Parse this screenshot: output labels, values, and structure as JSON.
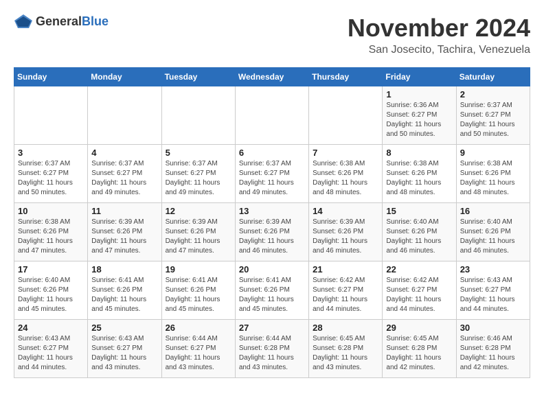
{
  "logo": {
    "general": "General",
    "blue": "Blue"
  },
  "title": "November 2024",
  "subtitle": "San Josecito, Tachira, Venezuela",
  "days_of_week": [
    "Sunday",
    "Monday",
    "Tuesday",
    "Wednesday",
    "Thursday",
    "Friday",
    "Saturday"
  ],
  "weeks": [
    [
      {
        "day": "",
        "info": ""
      },
      {
        "day": "",
        "info": ""
      },
      {
        "day": "",
        "info": ""
      },
      {
        "day": "",
        "info": ""
      },
      {
        "day": "",
        "info": ""
      },
      {
        "day": "1",
        "info": "Sunrise: 6:36 AM\nSunset: 6:27 PM\nDaylight: 11 hours\nand 50 minutes."
      },
      {
        "day": "2",
        "info": "Sunrise: 6:37 AM\nSunset: 6:27 PM\nDaylight: 11 hours\nand 50 minutes."
      }
    ],
    [
      {
        "day": "3",
        "info": "Sunrise: 6:37 AM\nSunset: 6:27 PM\nDaylight: 11 hours\nand 50 minutes."
      },
      {
        "day": "4",
        "info": "Sunrise: 6:37 AM\nSunset: 6:27 PM\nDaylight: 11 hours\nand 49 minutes."
      },
      {
        "day": "5",
        "info": "Sunrise: 6:37 AM\nSunset: 6:27 PM\nDaylight: 11 hours\nand 49 minutes."
      },
      {
        "day": "6",
        "info": "Sunrise: 6:37 AM\nSunset: 6:27 PM\nDaylight: 11 hours\nand 49 minutes."
      },
      {
        "day": "7",
        "info": "Sunrise: 6:38 AM\nSunset: 6:26 PM\nDaylight: 11 hours\nand 48 minutes."
      },
      {
        "day": "8",
        "info": "Sunrise: 6:38 AM\nSunset: 6:26 PM\nDaylight: 11 hours\nand 48 minutes."
      },
      {
        "day": "9",
        "info": "Sunrise: 6:38 AM\nSunset: 6:26 PM\nDaylight: 11 hours\nand 48 minutes."
      }
    ],
    [
      {
        "day": "10",
        "info": "Sunrise: 6:38 AM\nSunset: 6:26 PM\nDaylight: 11 hours\nand 47 minutes."
      },
      {
        "day": "11",
        "info": "Sunrise: 6:39 AM\nSunset: 6:26 PM\nDaylight: 11 hours\nand 47 minutes."
      },
      {
        "day": "12",
        "info": "Sunrise: 6:39 AM\nSunset: 6:26 PM\nDaylight: 11 hours\nand 47 minutes."
      },
      {
        "day": "13",
        "info": "Sunrise: 6:39 AM\nSunset: 6:26 PM\nDaylight: 11 hours\nand 46 minutes."
      },
      {
        "day": "14",
        "info": "Sunrise: 6:39 AM\nSunset: 6:26 PM\nDaylight: 11 hours\nand 46 minutes."
      },
      {
        "day": "15",
        "info": "Sunrise: 6:40 AM\nSunset: 6:26 PM\nDaylight: 11 hours\nand 46 minutes."
      },
      {
        "day": "16",
        "info": "Sunrise: 6:40 AM\nSunset: 6:26 PM\nDaylight: 11 hours\nand 46 minutes."
      }
    ],
    [
      {
        "day": "17",
        "info": "Sunrise: 6:40 AM\nSunset: 6:26 PM\nDaylight: 11 hours\nand 45 minutes."
      },
      {
        "day": "18",
        "info": "Sunrise: 6:41 AM\nSunset: 6:26 PM\nDaylight: 11 hours\nand 45 minutes."
      },
      {
        "day": "19",
        "info": "Sunrise: 6:41 AM\nSunset: 6:26 PM\nDaylight: 11 hours\nand 45 minutes."
      },
      {
        "day": "20",
        "info": "Sunrise: 6:41 AM\nSunset: 6:26 PM\nDaylight: 11 hours\nand 45 minutes."
      },
      {
        "day": "21",
        "info": "Sunrise: 6:42 AM\nSunset: 6:27 PM\nDaylight: 11 hours\nand 44 minutes."
      },
      {
        "day": "22",
        "info": "Sunrise: 6:42 AM\nSunset: 6:27 PM\nDaylight: 11 hours\nand 44 minutes."
      },
      {
        "day": "23",
        "info": "Sunrise: 6:43 AM\nSunset: 6:27 PM\nDaylight: 11 hours\nand 44 minutes."
      }
    ],
    [
      {
        "day": "24",
        "info": "Sunrise: 6:43 AM\nSunset: 6:27 PM\nDaylight: 11 hours\nand 44 minutes."
      },
      {
        "day": "25",
        "info": "Sunrise: 6:43 AM\nSunset: 6:27 PM\nDaylight: 11 hours\nand 43 minutes."
      },
      {
        "day": "26",
        "info": "Sunrise: 6:44 AM\nSunset: 6:27 PM\nDaylight: 11 hours\nand 43 minutes."
      },
      {
        "day": "27",
        "info": "Sunrise: 6:44 AM\nSunset: 6:28 PM\nDaylight: 11 hours\nand 43 minutes."
      },
      {
        "day": "28",
        "info": "Sunrise: 6:45 AM\nSunset: 6:28 PM\nDaylight: 11 hours\nand 43 minutes."
      },
      {
        "day": "29",
        "info": "Sunrise: 6:45 AM\nSunset: 6:28 PM\nDaylight: 11 hours\nand 42 minutes."
      },
      {
        "day": "30",
        "info": "Sunrise: 6:46 AM\nSunset: 6:28 PM\nDaylight: 11 hours\nand 42 minutes."
      }
    ]
  ]
}
